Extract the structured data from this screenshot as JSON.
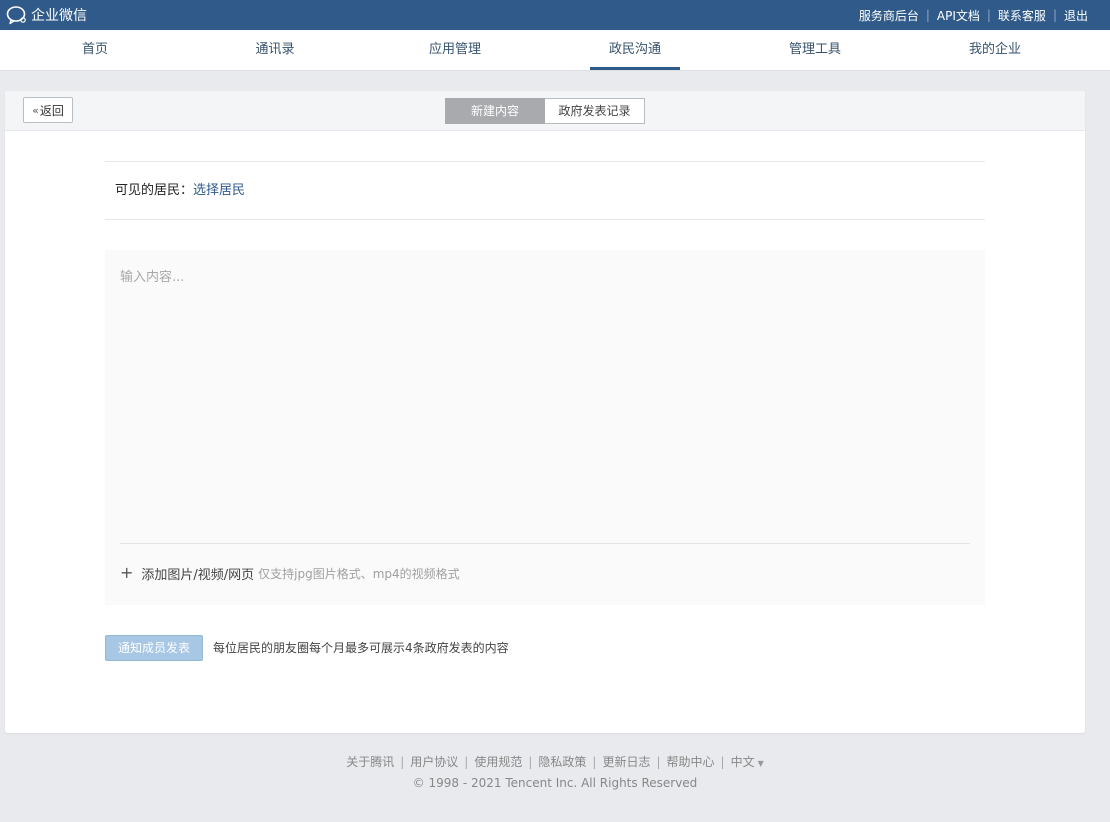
{
  "topbar": {
    "brand": "企业微信",
    "links": [
      "服务商后台",
      "API文档",
      "联系客服",
      "退出"
    ]
  },
  "nav": {
    "tabs": [
      "首页",
      "通讯录",
      "应用管理",
      "政民沟通",
      "管理工具",
      "我的企业"
    ],
    "active": "政民沟通"
  },
  "card": {
    "back_label": "返回",
    "segments": [
      "新建内容",
      "政府发表记录"
    ],
    "visible_label": "可见的居民：",
    "visible_link": "选择居民",
    "editor_placeholder": "输入内容...",
    "attach_label": "添加图片/视频/网页",
    "attach_hint": "仅支持jpg图片格式、mp4的视频格式",
    "publish_label": "通知成员发表",
    "publish_note": "每位居民的朋友圈每个月最多可展示4条政府发表的内容"
  },
  "footer": {
    "links": [
      "关于腾讯",
      "用户协议",
      "使用规范",
      "隐私政策",
      "更新日志",
      "帮助中心"
    ],
    "language": "中文",
    "copyright": "© 1998 - 2021 Tencent Inc. All Rights Reserved"
  },
  "colors": {
    "topbar": "#2f5a8a",
    "nav_text": "#37526e",
    "publish_button": "#a7c7e4",
    "segment_active": "#a8aaad"
  }
}
